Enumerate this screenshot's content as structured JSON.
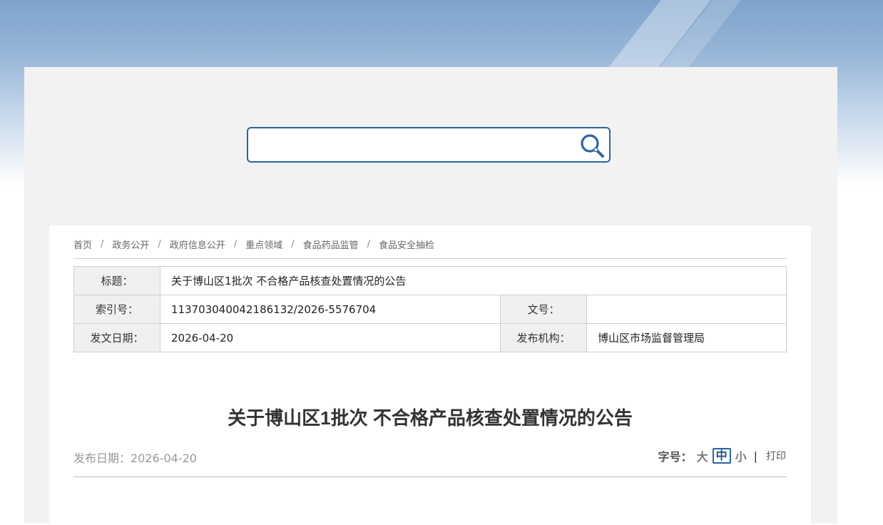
{
  "search": {
    "placeholder": "",
    "value": ""
  },
  "breadcrumb": [
    "首页",
    "政务公开",
    "政府信息公开",
    "重点领域",
    "食品药品监管",
    "食品安全抽检"
  ],
  "breadcrumb_sep": "/",
  "meta": {
    "title_label": "标题：",
    "title_value": "关于博山区1批次 不合格产品核查处置情况的公告",
    "index_label": "索引号：",
    "index_value": "113703040042186132/2026-5576704",
    "docno_label": "文号：",
    "docno_value": "",
    "date_label": "发文日期：",
    "date_value": "2026-04-20",
    "org_label": "发布机构：",
    "org_value": "博山区市场监督管理局"
  },
  "article": {
    "title": "关于博山区1批次 不合格产品核查处置情况的公告",
    "pub_date": "发布日期：2026-04-20"
  },
  "tools": {
    "font_label": "字号：",
    "large": "大",
    "medium": "中",
    "small": "小",
    "divider": "|",
    "print": "打印"
  },
  "colors": {
    "accent": "#2d64a0",
    "frame_bg": "#f2f2f2"
  }
}
